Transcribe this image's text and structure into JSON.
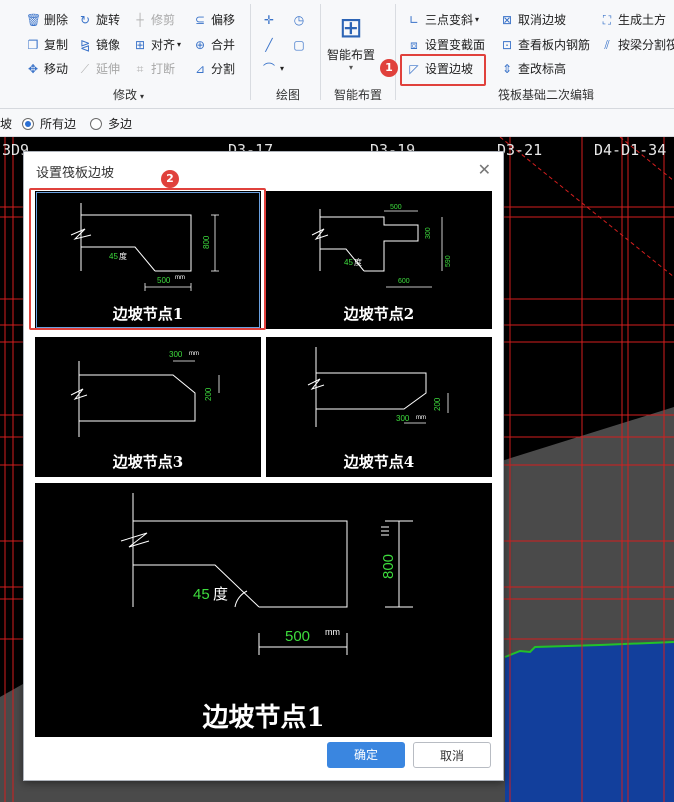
{
  "ribbon": {
    "modify": {
      "label": "修改",
      "items": {
        "delete": "删除",
        "rotate": "旋转",
        "trim": "修剪",
        "offset": "偏移",
        "copy": "复制",
        "mirror": "镜像",
        "align": "对齐",
        "merge": "合并",
        "move": "移动",
        "extend": "延伸",
        "break": "打断",
        "split": "分割"
      }
    },
    "draw": {
      "label": "绘图"
    },
    "smart_layout": {
      "label": "智能布置",
      "button": "智能布置"
    },
    "raft": {
      "label": "筏板基础二次编辑",
      "three_point_slope": "三点变斜",
      "cancel_slope": "取消边坡",
      "gen_earthwork": "生成土方",
      "set_section": "设置变截面",
      "view_rebar": "查看板内钢筋",
      "split_by_beam": "按梁分割筏",
      "set_slope": "设置边坡",
      "edit_elevation": "查改标高"
    },
    "badge1": "1"
  },
  "options": {
    "partial": "坡",
    "all_edges": "所有边",
    "multi_edges": "多边"
  },
  "axes": {
    "a": "3D9",
    "b": "D3-17",
    "c": "D3-19",
    "d": "D3-21",
    "e": "D4-D1-34"
  },
  "dialog": {
    "title": "设置筏板边坡",
    "badge2": "2",
    "tiles": [
      {
        "label": "边坡节点1",
        "angle": "45",
        "angle_unit": "度",
        "width": "500",
        "height": "800",
        "unit": "mm"
      },
      {
        "label": "边坡节点2",
        "angle": "45",
        "angle_unit": "度",
        "top": "500",
        "mid": "300",
        "height": "590",
        "bottom": "600",
        "unit": "mm"
      },
      {
        "label": "边坡节点3",
        "width": "300",
        "height": "200",
        "unit": "mm"
      },
      {
        "label": "边坡节点4",
        "width": "300",
        "height": "200",
        "unit": "mm"
      }
    ],
    "preview": {
      "label": "边坡节点1",
      "angle": "45",
      "angle_unit": "度",
      "width": "500",
      "height": "800",
      "unit": "mm"
    },
    "ok": "确定",
    "cancel": "取消"
  },
  "colors": {
    "accent": "#3a86e0",
    "highlight": "#e0413c",
    "grid_red": "#d41e1e",
    "fill_blue": "#123f9c",
    "dim_green": "#3ddc3d"
  }
}
